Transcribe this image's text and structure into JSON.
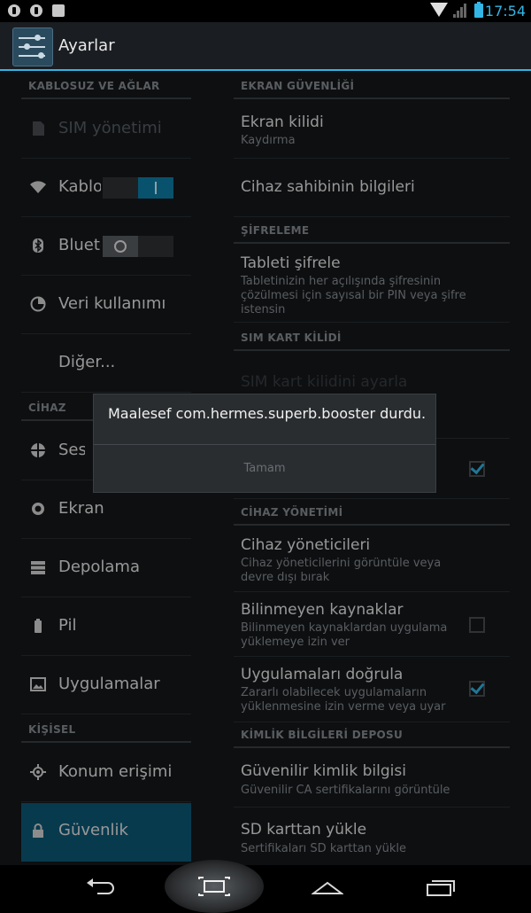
{
  "status_bar": {
    "time": "17:54"
  },
  "action_bar": {
    "title": "Ayarlar",
    "icon": "settings-icon"
  },
  "left_panel": {
    "sections": [
      {
        "header": "KABLOSUZ VE AĞLAR",
        "items": [
          {
            "label": "SIM yönetimi",
            "icon": "sim-icon",
            "enabled": false
          },
          {
            "label": "Kablosuz",
            "icon": "wifi-icon",
            "toggle": "on"
          },
          {
            "label": "Bluetooth",
            "icon": "bluetooth-icon",
            "toggle": "off"
          },
          {
            "label": "Veri kullanımı",
            "icon": "data-usage-icon"
          },
          {
            "label": "Diğer..."
          }
        ]
      },
      {
        "header": "CİHAZ",
        "items": [
          {
            "label": "Ses profilleri",
            "icon": "sound-icon"
          },
          {
            "label": "Ekran",
            "icon": "display-icon"
          },
          {
            "label": "Depolama",
            "icon": "storage-icon"
          },
          {
            "label": "Pil",
            "icon": "battery-icon"
          },
          {
            "label": "Uygulamalar",
            "icon": "apps-icon"
          }
        ]
      },
      {
        "header": "KİŞİSEL",
        "items": [
          {
            "label": "Konum erişimi",
            "icon": "location-icon"
          },
          {
            "label": "Güvenlik",
            "icon": "lock-icon",
            "selected": true
          }
        ]
      }
    ]
  },
  "right_panel": {
    "sections": [
      {
        "header": "EKRAN GÜVENLİĞİ",
        "items": [
          {
            "title": "Ekran kilidi",
            "subtitle": "Kaydırma"
          },
          {
            "title": "Cihaz sahibinin bilgileri"
          }
        ]
      },
      {
        "header": "ŞİFRELEME",
        "items": [
          {
            "title": "Tableti şifrele",
            "subtitle": "Tabletinizin her açılışında şifresinin çözülmesi için sayısal bir PIN veya şifre istensin"
          }
        ]
      },
      {
        "header": "SIM KART KİLİDİ",
        "items": [
          {
            "title": "SIM kart kilidini ayarla",
            "enabled": false
          }
        ]
      },
      {
        "header": "CİHAZ YÖNETİMİ",
        "items": [
          {
            "title": "Cihaz yöneticileri",
            "subtitle": "Cihaz yöneticilerini görüntüle veya devre dışı bırak"
          },
          {
            "title": "Bilinmeyen kaynaklar",
            "subtitle": "Bilinmeyen kaynaklardan uygulama yüklemeye izin ver",
            "checked": false
          },
          {
            "title": "Uygulamaları doğrula",
            "subtitle": "Zararlı olabilecek uygulamaların yüklenmesine izin verme veya uyar",
            "checked": true
          }
        ]
      },
      {
        "header": "KİMLİK BİLGİLERİ DEPOSU",
        "items": [
          {
            "title": "Güvenilir kimlik bilgisi",
            "subtitle": "Güvenilir CA sertifikalarını görüntüle"
          },
          {
            "title": "SD karttan yükle",
            "subtitle": "Sertifikaları SD karttan yükle"
          }
        ]
      }
    ],
    "hidden_checkbox_checked": true
  },
  "dialog": {
    "message": "Maalesef com.hermes.superb.booster durdu.",
    "button": "Tamam"
  },
  "nav_bar": {
    "back": "back-icon",
    "recent_screenshot": "screenshot-icon",
    "home": "home-icon",
    "recents": "recents-icon"
  }
}
